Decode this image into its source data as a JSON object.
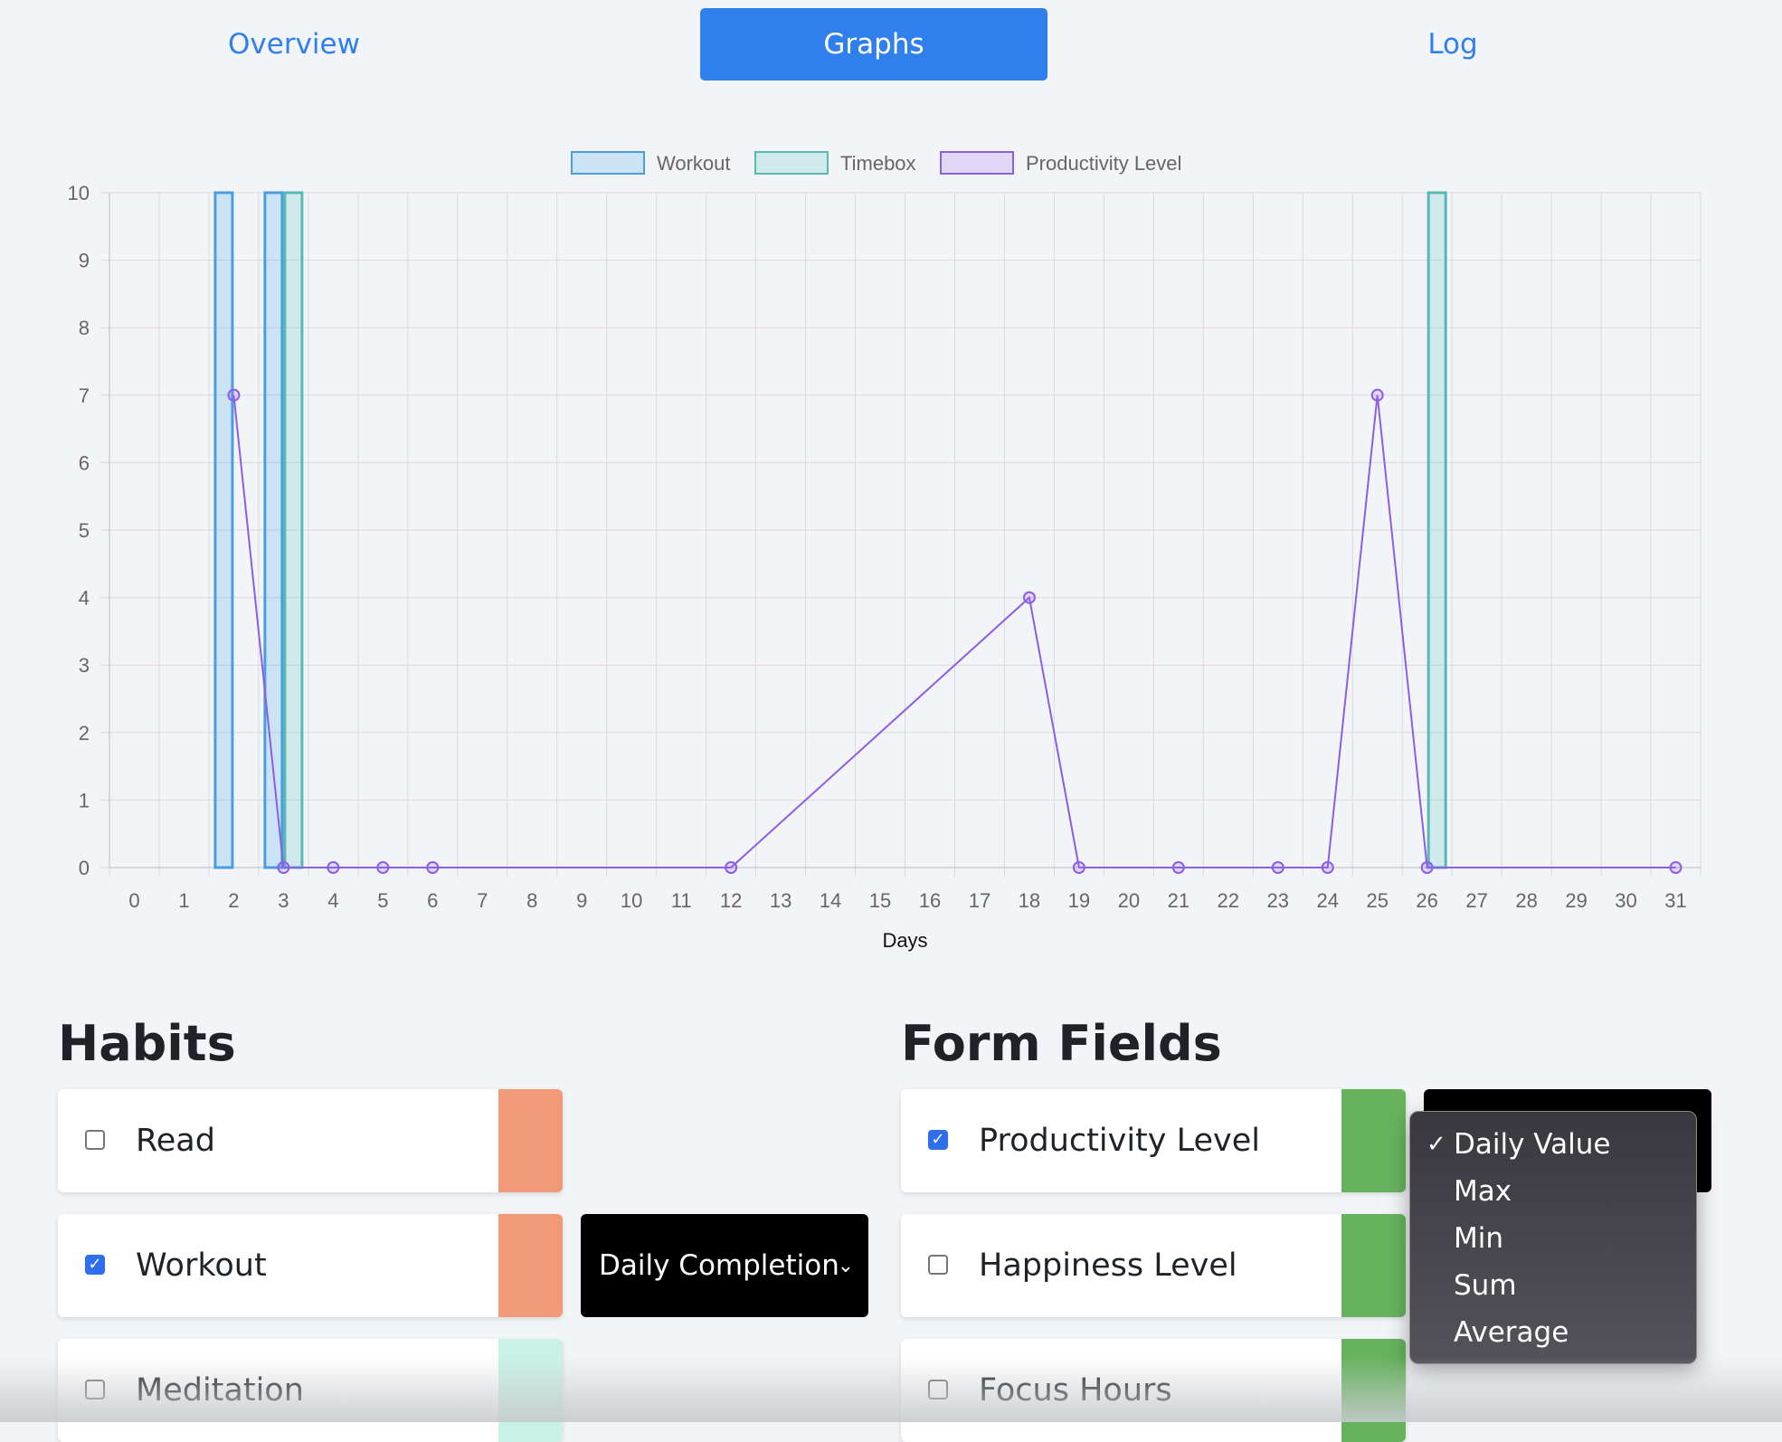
{
  "nav": {
    "tabs": [
      {
        "label": "Overview",
        "active": false
      },
      {
        "label": "Graphs",
        "active": true
      },
      {
        "label": "Log",
        "active": false
      }
    ]
  },
  "colors": {
    "accent": "#2f80ed",
    "workout_fill": "rgba(54,162,235,0.2)",
    "workout_border": "#4a9de0",
    "timebox_fill": "rgba(75,192,192,0.2)",
    "timebox_border": "#5ab8b4",
    "productivity_fill": "rgba(153,102,255,0.2)",
    "productivity_border": "#8a5ee6",
    "read_swatch": "#f09a78",
    "workout_swatch": "#f09a78",
    "meditation_swatch": "#c9f2e6",
    "field_swatch": "#66b35e"
  },
  "chart_data": {
    "type": "bar",
    "xlabel": "Days",
    "ylabel": "",
    "ylim": [
      0,
      10
    ],
    "yticks": [
      "0",
      "1",
      "2",
      "3",
      "4",
      "5",
      "6",
      "7",
      "8",
      "9",
      "10"
    ],
    "categories": [
      "0",
      "1",
      "2",
      "3",
      "4",
      "5",
      "6",
      "7",
      "8",
      "9",
      "10",
      "11",
      "12",
      "13",
      "14",
      "15",
      "16",
      "17",
      "18",
      "19",
      "20",
      "21",
      "22",
      "23",
      "24",
      "25",
      "26",
      "27",
      "28",
      "29",
      "30",
      "31"
    ],
    "legend_position": "top-center",
    "grid": true,
    "series": [
      {
        "name": "Workout",
        "type": "bar",
        "points": [
          {
            "x": 2,
            "y": 10
          },
          {
            "x": 3,
            "y": 10
          }
        ]
      },
      {
        "name": "Timebox",
        "type": "bar",
        "points": [
          {
            "x": 3,
            "y": 10
          },
          {
            "x": 26,
            "y": 10
          }
        ]
      },
      {
        "name": "Productivity Level",
        "type": "line",
        "points": [
          {
            "x": 2,
            "y": 7
          },
          {
            "x": 3,
            "y": 0
          },
          {
            "x": 4,
            "y": 0
          },
          {
            "x": 5,
            "y": 0
          },
          {
            "x": 6,
            "y": 0
          },
          {
            "x": 12,
            "y": 0
          },
          {
            "x": 18,
            "y": 4
          },
          {
            "x": 19,
            "y": 0
          },
          {
            "x": 21,
            "y": 0
          },
          {
            "x": 23,
            "y": 0
          },
          {
            "x": 24,
            "y": 0
          },
          {
            "x": 25,
            "y": 7
          },
          {
            "x": 26,
            "y": 0
          },
          {
            "x": 31,
            "y": 0
          }
        ]
      }
    ]
  },
  "habits": {
    "title": "Habits",
    "items": [
      {
        "label": "Read",
        "checked": false
      },
      {
        "label": "Workout",
        "checked": true
      },
      {
        "label": "Meditation",
        "checked": false
      }
    ],
    "select_value": "Daily Completion"
  },
  "form_fields": {
    "title": "Form Fields",
    "items": [
      {
        "label": "Productivity Level",
        "checked": true
      },
      {
        "label": "Happiness Level",
        "checked": false
      },
      {
        "label": "Focus Hours",
        "checked": false
      }
    ],
    "dropdown": {
      "selected": "Daily Value",
      "options": [
        "Daily Value",
        "Max",
        "Min",
        "Sum",
        "Average"
      ]
    }
  }
}
